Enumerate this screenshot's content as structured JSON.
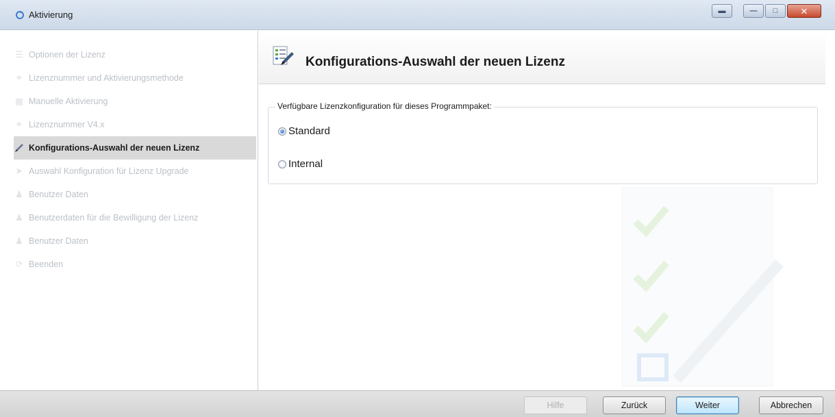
{
  "window": {
    "title": "Aktivierung",
    "icon": "activation-icon"
  },
  "sidebar": {
    "items": [
      {
        "label": "Optionen der Lizenz",
        "icon": "options-icon",
        "active": false
      },
      {
        "label": "Lizenznummer und Aktivierungsmethode",
        "icon": "key-icon",
        "active": false
      },
      {
        "label": "Manuelle Aktivierung",
        "icon": "calendar-icon",
        "active": false
      },
      {
        "label": "Lizenznummer V4.x",
        "icon": "key-icon",
        "active": false
      },
      {
        "label": "Konfigurations-Auswahl der neuen Lizenz",
        "icon": "pen-icon",
        "active": true
      },
      {
        "label": "Auswahl Konfiguration für Lizenz Upgrade",
        "icon": "upgrade-icon",
        "active": false
      },
      {
        "label": "Benutzer Daten",
        "icon": "user-icon",
        "active": false
      },
      {
        "label": "Benutzerdaten für die Bewilligung der Lizenz",
        "icon": "user-icon",
        "active": false
      },
      {
        "label": "Benutzer Daten",
        "icon": "user-icon",
        "active": false
      },
      {
        "label": "Beenden",
        "icon": "finish-icon",
        "active": false
      }
    ]
  },
  "header": {
    "title": "Konfigurations-Auswahl der neuen Lizenz",
    "icon": "checklist-pen-icon"
  },
  "config": {
    "legend": "Verfügbare Lizenzkonfiguration für dieses Programmpaket:",
    "options": [
      {
        "label": "Standard",
        "checked": true
      },
      {
        "label": "Internal",
        "checked": false
      }
    ]
  },
  "footer": {
    "help_label": "Hilfe",
    "back_label": "Zurück",
    "next_label": "Weiter",
    "cancel_label": "Abbrechen"
  },
  "colors": {
    "titlebar": "#cdd9e8",
    "close_button": "#c74a2e",
    "active_nav_bg": "#d9d9d9",
    "default_button_border": "#3c7fb1"
  }
}
